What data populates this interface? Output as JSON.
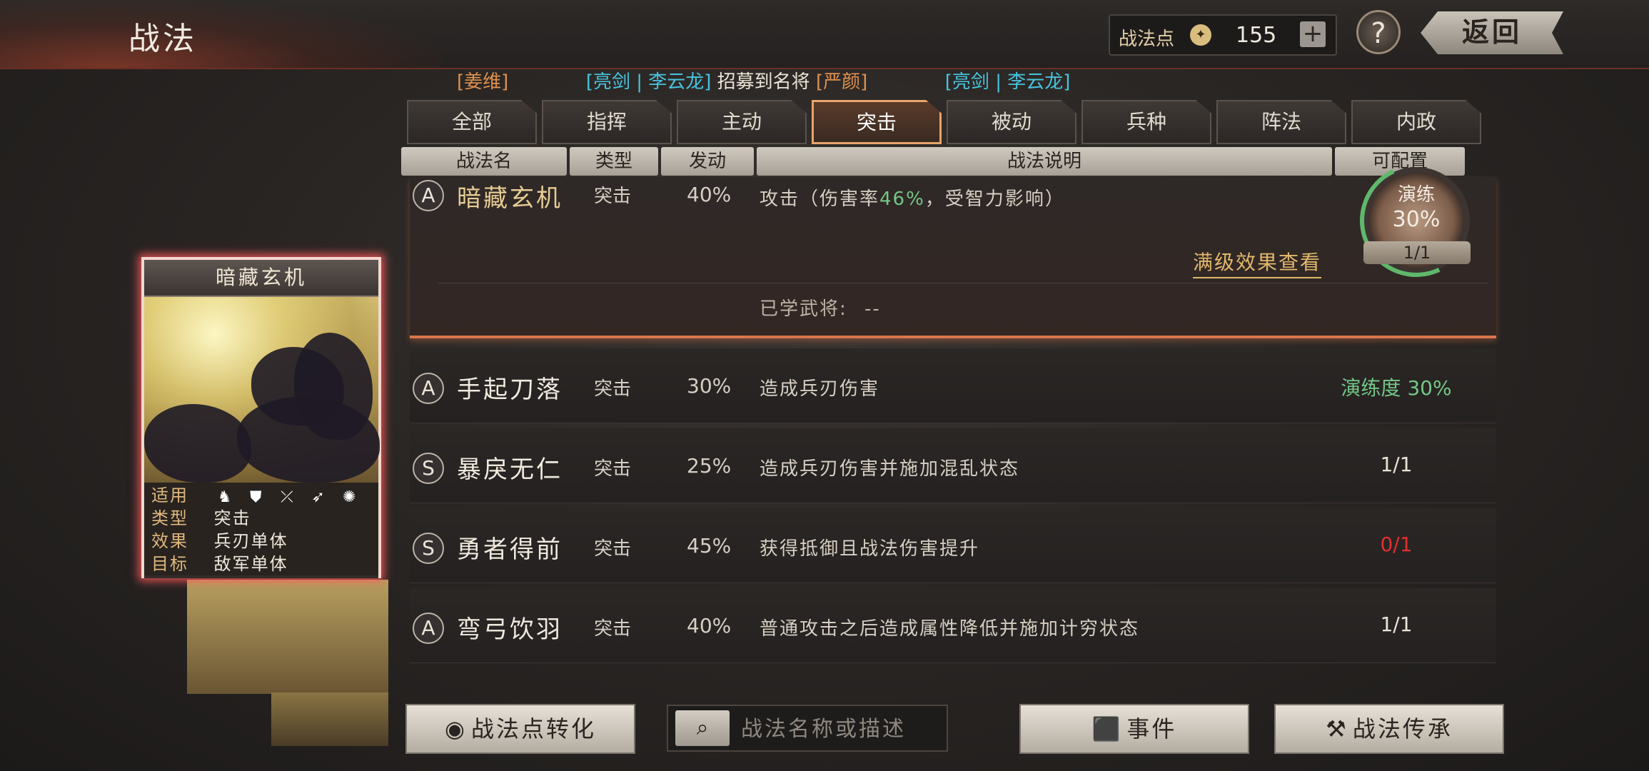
{
  "header": {
    "title": "战法",
    "points_label": "战法点",
    "points_value": "155",
    "plus_label": "+",
    "help_label": "?",
    "back_label": "返回"
  },
  "ticker": [
    {
      "text": "[姜维]",
      "color": "orange"
    },
    {
      "text": "[亮剑 | 李云龙]",
      "color": "cyan"
    },
    {
      "text": "招募到名将",
      "color": "white"
    },
    {
      "text": "[严颜]",
      "color": "orange"
    },
    {
      "text": "[亮剑 | 李云龙]",
      "color": "cyan"
    }
  ],
  "tabs": [
    {
      "label": "全部",
      "active": false
    },
    {
      "label": "指挥",
      "active": false
    },
    {
      "label": "主动",
      "active": false
    },
    {
      "label": "突击",
      "active": true
    },
    {
      "label": "被动",
      "active": false
    },
    {
      "label": "兵种",
      "active": false
    },
    {
      "label": "阵法",
      "active": false
    },
    {
      "label": "内政",
      "active": false
    }
  ],
  "columns": [
    "战法名",
    "类型",
    "发动",
    "战法说明",
    "可配置"
  ],
  "expanded": {
    "grade": "A",
    "name": "暗藏玄机",
    "type": "突击",
    "rate": "40%",
    "desc_prefix": "攻击（伤害率",
    "desc_highlight": "46%",
    "desc_suffix": "，受智力影响）",
    "drill_label": "演练",
    "drill_percent": "30%",
    "drill_count": "1/1",
    "max_effect_link": "满级效果查看",
    "learned_label": "已学武将:",
    "learned_value": "--"
  },
  "rows": [
    {
      "grade": "A",
      "name": "手起刀落",
      "type": "突击",
      "rate": "30%",
      "desc": "造成兵刃伤害",
      "config": "演练度 30%",
      "config_color": "green"
    },
    {
      "grade": "S",
      "name": "暴戾无仁",
      "type": "突击",
      "rate": "25%",
      "desc": "造成兵刃伤害并施加混乱状态",
      "config": "1/1",
      "config_color": "white"
    },
    {
      "grade": "S",
      "name": "勇者得前",
      "type": "突击",
      "rate": "45%",
      "desc": "获得抵御且战法伤害提升",
      "config": "0/1",
      "config_color": "red"
    },
    {
      "grade": "A",
      "name": "弯弓饮羽",
      "type": "突击",
      "rate": "40%",
      "desc": "普通攻击之后造成属性降低并施加计穷状态",
      "config": "1/1",
      "config_color": "white"
    }
  ],
  "card": {
    "title": "暗藏玄机",
    "applies_label": "适用",
    "unit_icons": [
      "cavalry-icon",
      "shield-icon",
      "bow-icon",
      "spear-icon",
      "chariot-icon"
    ],
    "type_label": "类型",
    "type_value": "突击",
    "effect_label": "效果",
    "effect_value": "兵刃单体",
    "target_label": "目标",
    "target_value": "敌军单体"
  },
  "bottom": {
    "convert_label": "战法点转化",
    "search_placeholder": "战法名称或描述",
    "events_label": "事件",
    "inherit_label": "战法传承"
  },
  "colors": {
    "accent_orange": "#e8a46a",
    "highlight_green": "#74c686",
    "warning_red": "#e03030",
    "ticker_cyan": "#47c4de",
    "ticker_orange": "#e0914e"
  }
}
